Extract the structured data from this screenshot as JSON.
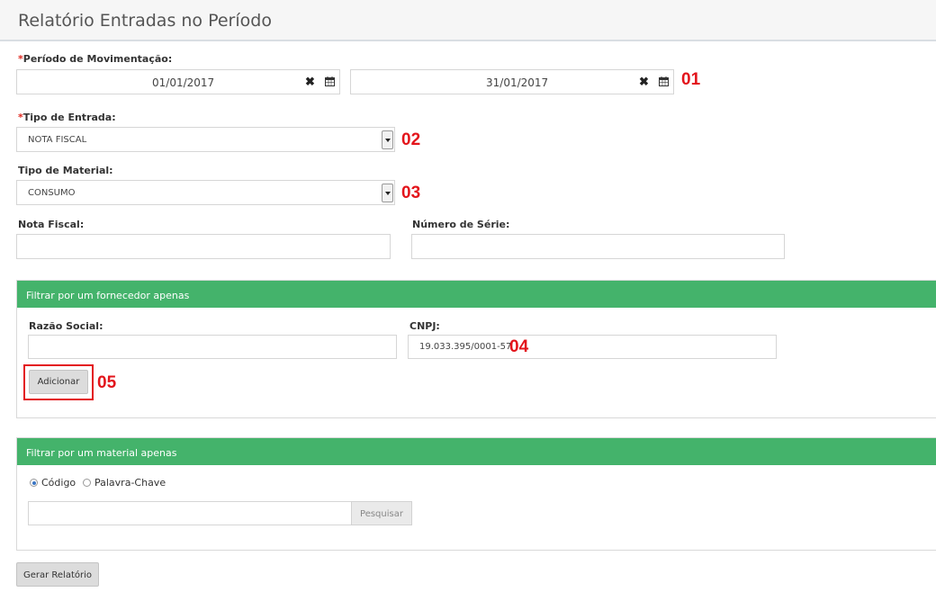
{
  "header": {
    "title": "Relatório Entradas no Período"
  },
  "periodo": {
    "required_mark": "*",
    "label": "Período de Movimentação:",
    "start_value": "01/01/2017",
    "end_value": "31/01/2017",
    "clear_glyph": "✖",
    "calendar_icon": "calendar-icon"
  },
  "tipo_entrada": {
    "required_mark": "*",
    "label": "Tipo de Entrada:",
    "value": "NOTA FISCAL"
  },
  "tipo_material": {
    "label": "Tipo de Material:",
    "value": "CONSUMO"
  },
  "nota_fiscal": {
    "label": "Nota Fiscal:",
    "value": ""
  },
  "numero_serie": {
    "label": "Número de Série:",
    "value": ""
  },
  "fornecedor": {
    "heading": "Filtrar por um fornecedor apenas",
    "razao_label": "Razão Social:",
    "razao_value": "",
    "cnpj_label": "CNPJ:",
    "cnpj_value": "19.033.395/0001-57",
    "add_button": "Adicionar"
  },
  "material": {
    "heading": "Filtrar por um material apenas",
    "option_codigo": "Código",
    "option_palavra": "Palavra-Chave",
    "selected": "Código",
    "search_value": "",
    "search_button": "Pesquisar"
  },
  "footer": {
    "generate_button": "Gerar Relatório"
  },
  "annotations": [
    "01",
    "02",
    "03",
    "04",
    "05"
  ],
  "colors": {
    "panel_header": "#44b36b",
    "annotation": "#e3141b",
    "required": "#e0281f"
  }
}
